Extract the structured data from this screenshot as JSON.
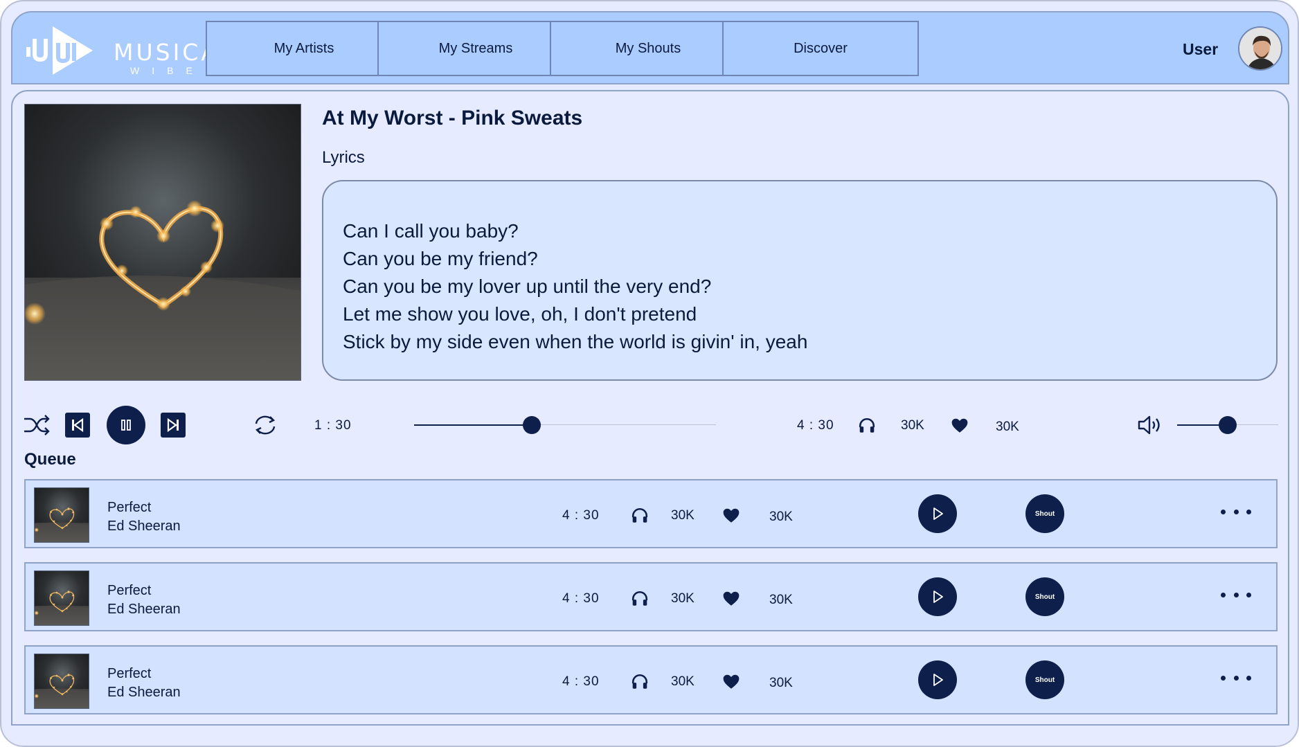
{
  "brand": {
    "name": "MUSICAL",
    "sub": "WIBES"
  },
  "nav": [
    {
      "label": "My Artists"
    },
    {
      "label": "My Streams"
    },
    {
      "label": "My Shouts"
    },
    {
      "label": "Discover"
    }
  ],
  "user": {
    "label": "User"
  },
  "now_playing": {
    "title": "At My Worst - Pink Sweats",
    "lyrics_label": "Lyrics",
    "lyrics": [
      "Can I call you baby?",
      "Can you be my friend?",
      "Can you be my lover up until the very end?",
      "Let me show you love, oh, I don't pretend",
      "Stick by my side even when the world is givin' in, yeah"
    ]
  },
  "player": {
    "current_time": "1 : 30",
    "total_time": "4 : 30",
    "progress_fraction": 0.39,
    "listens": "30K",
    "likes": "30K",
    "volume_fraction": 0.5
  },
  "queue": {
    "label": "Queue",
    "items": [
      {
        "title": "Perfect",
        "artist": "Ed Sheeran",
        "duration": "4 : 30",
        "listens": "30K",
        "likes": "30K",
        "shout_label": "Shout"
      },
      {
        "title": "Perfect",
        "artist": "Ed Sheeran",
        "duration": "4 : 30",
        "listens": "30K",
        "likes": "30K",
        "shout_label": "Shout"
      },
      {
        "title": "Perfect",
        "artist": "Ed Sheeran",
        "duration": "4 : 30",
        "listens": "30K",
        "likes": "30K",
        "shout_label": "Shout"
      }
    ]
  },
  "colors": {
    "accent": "#0d1f4a",
    "header_bg": "#aaccff",
    "page_bg": "#e6ebff",
    "row_bg": "#d3e2ff",
    "lyrics_bg": "#d9e6ff"
  }
}
